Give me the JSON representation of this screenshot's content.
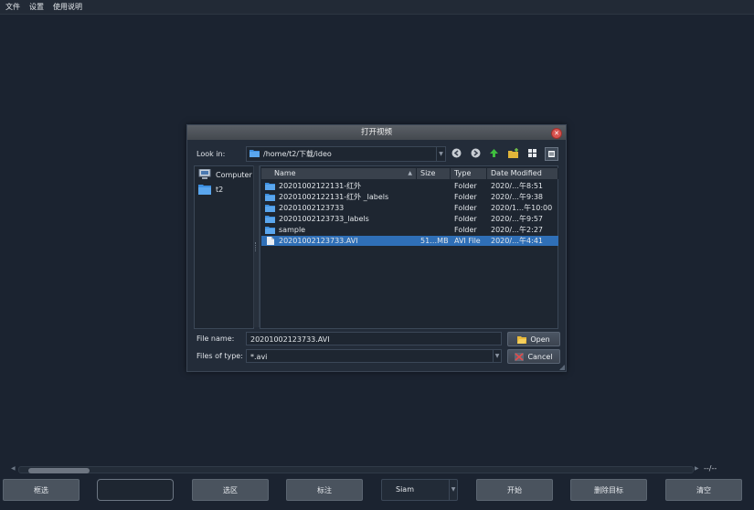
{
  "menubar": {
    "items": [
      "文件",
      "设置",
      "使用说明"
    ]
  },
  "dialog": {
    "title": "打开视频",
    "look_in_label": "Look in:",
    "look_in_path": "/home/t2/下载/ideo",
    "sidebar": [
      "Computer",
      "t2"
    ],
    "columns": [
      "Name",
      "Size",
      "Type",
      "Date Modified"
    ],
    "files": [
      {
        "name": "20201002122131-红外",
        "size": "",
        "type": "Folder",
        "date": "2020/…午8:51",
        "kind": "folder",
        "selected": false
      },
      {
        "name": "20201002122131-红外 _labels",
        "size": "",
        "type": "Folder",
        "date": "2020/…午9:38",
        "kind": "folder",
        "selected": false
      },
      {
        "name": "20201002123733",
        "size": "",
        "type": "Folder",
        "date": "2020/1…午10:00",
        "kind": "folder",
        "selected": false
      },
      {
        "name": "20201002123733_labels",
        "size": "",
        "type": "Folder",
        "date": "2020/…午9:57",
        "kind": "folder",
        "selected": false
      },
      {
        "name": "sample",
        "size": "",
        "type": "Folder",
        "date": "2020/…午2:27",
        "kind": "folder",
        "selected": false
      },
      {
        "name": "20201002123733.AVI",
        "size": "51…MB",
        "type": "AVI File",
        "date": "2020/…午4:41",
        "kind": "file",
        "selected": true
      }
    ],
    "file_name_label": "File name:",
    "file_name_value": "20201002123733.AVI",
    "file_type_label": "Files of type:",
    "file_type_value": "*.avi",
    "open_label": "Open",
    "cancel_label": "Cancel"
  },
  "frame_counter": "--/--",
  "bottom": {
    "button1": "框选",
    "button2": "选区",
    "button3": "标注",
    "tracker_value": "Siam",
    "button4": "开始",
    "button5": "删除目标",
    "button6": "清空"
  },
  "colors": {
    "selection": "#2f6fb7",
    "background": "#1b2330",
    "close": "#d9534f"
  }
}
